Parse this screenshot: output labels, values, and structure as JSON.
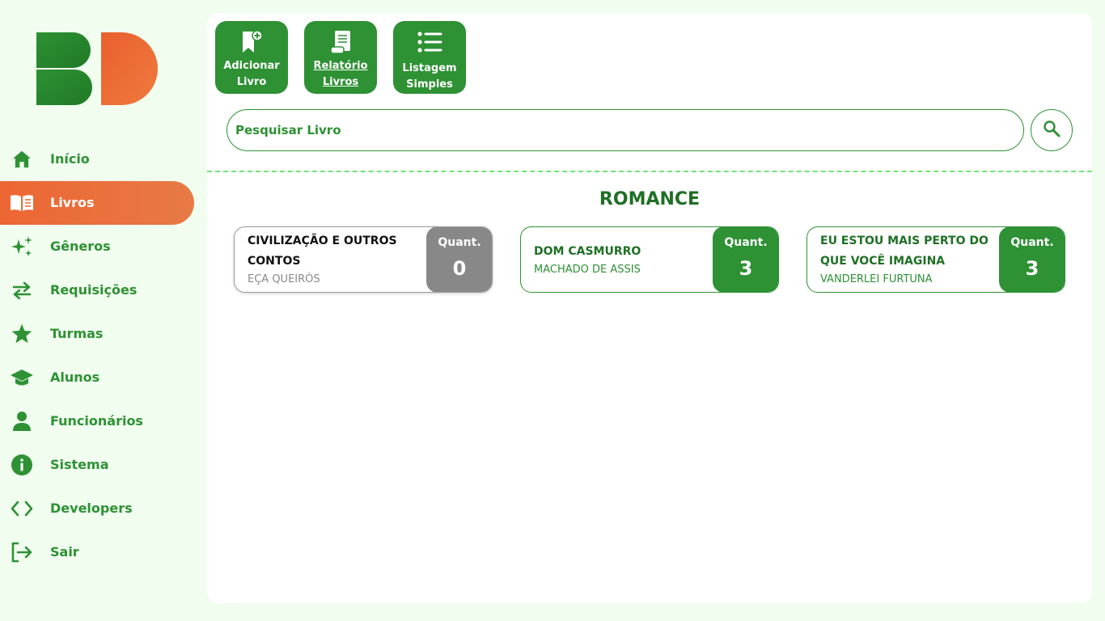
{
  "logo": {
    "text": "BD",
    "primary_color": "#2e9134",
    "secondary_color": "#ec6633"
  },
  "nav": {
    "active_index": 1,
    "items": [
      {
        "label": "Início",
        "icon": "home-icon"
      },
      {
        "label": "Livros",
        "icon": "book-icon"
      },
      {
        "label": "Gêneros",
        "icon": "sparkles-icon"
      },
      {
        "label": "Requisições",
        "icon": "swap-arrows-icon"
      },
      {
        "label": "Turmas",
        "icon": "star-icon"
      },
      {
        "label": "Alunos",
        "icon": "graduation-cap-icon"
      },
      {
        "label": "Funcionários",
        "icon": "person-icon"
      },
      {
        "label": "Sistema",
        "icon": "info-icon"
      },
      {
        "label": "Developers",
        "icon": "code-icon"
      },
      {
        "label": "Sair",
        "icon": "logout-icon"
      }
    ]
  },
  "toolbar": {
    "add_book": "Adicionar Livro",
    "report": "Relatório Livros",
    "simple_list": "Listagem Simples"
  },
  "search": {
    "placeholder": "Pesquisar Livro",
    "value": ""
  },
  "section": {
    "title": "ROMANCE"
  },
  "quantity_label": "Quant.",
  "books": [
    {
      "title": "CIVILIZAÇÃO E OUTROS CONTOS",
      "author": "EÇA QUEIRÓS",
      "quantity": "0"
    },
    {
      "title": "DOM CASMURRO",
      "author": "MACHADO DE ASSIS",
      "quantity": "3"
    },
    {
      "title": "EU ESTOU MAIS PERTO DO QUE VOCÊ IMAGINA",
      "author": "VANDERLEI FURTUNA",
      "quantity": "3"
    }
  ],
  "colors": {
    "accent": "#2e9134",
    "active_nav": "#ec6633",
    "background": "#f0fdef",
    "empty_stock": "#888888"
  }
}
